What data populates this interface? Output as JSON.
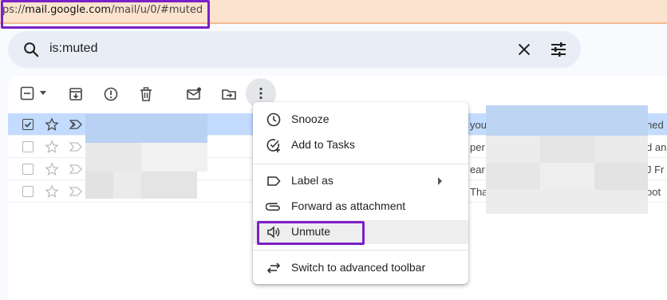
{
  "browser": {
    "url_prefix": "ps://",
    "url_host": "mail.google.com",
    "url_path": "/mail/u/0/#muted"
  },
  "search": {
    "query": "is:muted"
  },
  "toolbar": {
    "icons": [
      "select-checkbox-icon",
      "dropdown-arrow-icon",
      "archive-icon",
      "report-spam-icon",
      "delete-icon",
      "mark-unread-icon",
      "move-to-icon",
      "more-options-icon"
    ]
  },
  "rows": [
    {
      "selected": true,
      "snippet_mid": "you",
      "snippet_end": "ned"
    },
    {
      "selected": false,
      "snippet_mid": "per",
      "snippet_end": "d an"
    },
    {
      "selected": false,
      "snippet_mid": "ear",
      "snippet_end": "J Fr"
    },
    {
      "selected": false,
      "snippet_mid": "Tha",
      "snippet_end": "pot"
    }
  ],
  "menu": {
    "items": [
      {
        "label": "Snooze",
        "icon": "clock-icon"
      },
      {
        "label": "Add to Tasks",
        "icon": "add-task-icon"
      },
      {
        "label": "Label as",
        "icon": "label-icon",
        "has_submenu": true
      },
      {
        "label": "Forward as attachment",
        "icon": "attachment-icon"
      },
      {
        "label": "Unmute",
        "icon": "speaker-icon"
      },
      {
        "label": "Switch to advanced toolbar",
        "icon": "swap-icon"
      }
    ]
  },
  "colors": {
    "highlight_outline": "#7b20c8",
    "selected_row": "#c2dbff",
    "search_bg": "#e9eef6"
  }
}
